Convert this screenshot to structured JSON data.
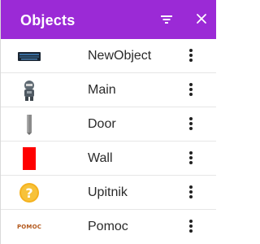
{
  "panel": {
    "title": "Objects",
    "header_color": "#9b2ad6",
    "filter_icon": "filter-icon",
    "close_icon": "close-icon"
  },
  "objects": [
    {
      "name": "NewObject",
      "thumbnail": "keyboard-sprite-icon",
      "menu_icon": "kebab-menu-icon"
    },
    {
      "name": "Main",
      "thumbnail": "robot-sprite-icon",
      "menu_icon": "kebab-menu-icon"
    },
    {
      "name": "Door",
      "thumbnail": "door-sprite-icon",
      "menu_icon": "kebab-menu-icon"
    },
    {
      "name": "Wall",
      "thumbnail": "red-block-sprite-icon",
      "menu_icon": "kebab-menu-icon"
    },
    {
      "name": "Upitnik",
      "thumbnail": "question-mark-sprite-icon",
      "menu_icon": "kebab-menu-icon"
    },
    {
      "name": "Pomoc",
      "thumbnail": "pomoc-text-sprite",
      "thumbnail_text": "POMOC",
      "menu_icon": "kebab-menu-icon"
    }
  ]
}
